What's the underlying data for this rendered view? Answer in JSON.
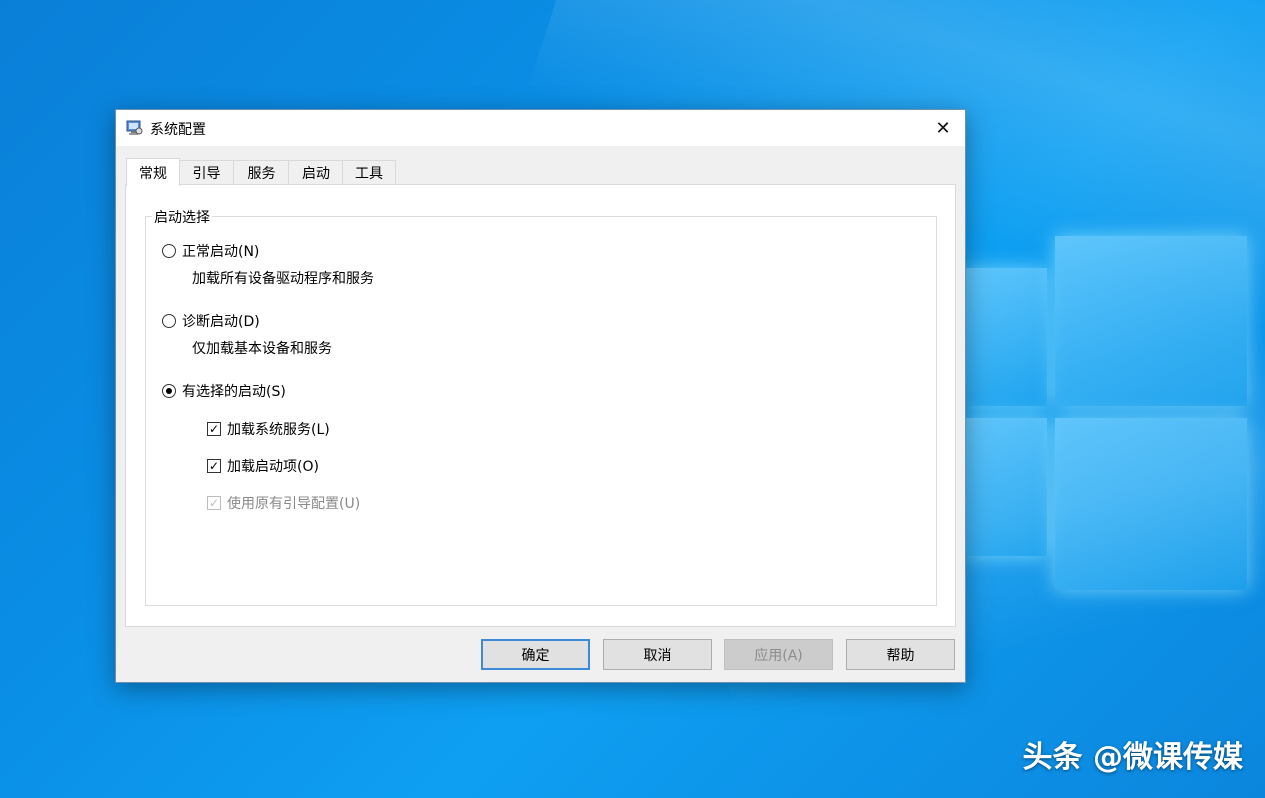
{
  "window": {
    "title": "系统配置",
    "close": "✕"
  },
  "tabs": [
    {
      "label": "常规",
      "active": true
    },
    {
      "label": "引导",
      "active": false
    },
    {
      "label": "服务",
      "active": false
    },
    {
      "label": "启动",
      "active": false
    },
    {
      "label": "工具",
      "active": false
    }
  ],
  "group": {
    "legend": "启动选择",
    "options": [
      {
        "label": "正常启动(N)",
        "desc": "加载所有设备驱动程序和服务",
        "selected": false
      },
      {
        "label": "诊断启动(D)",
        "desc": "仅加载基本设备和服务",
        "selected": false
      },
      {
        "label": "有选择的启动(S)",
        "selected": true
      }
    ],
    "checkboxes": [
      {
        "label": "加载系统服务(L)",
        "checked": true,
        "enabled": true
      },
      {
        "label": "加载启动项(O)",
        "checked": true,
        "enabled": true
      },
      {
        "label": "使用原有引导配置(U)",
        "checked": true,
        "enabled": false
      }
    ]
  },
  "buttons": {
    "ok": "确定",
    "cancel": "取消",
    "apply": "应用(A)",
    "help": "帮助"
  },
  "watermark": "头条 @微课传媒",
  "icons": {
    "checkmark": "✓"
  }
}
